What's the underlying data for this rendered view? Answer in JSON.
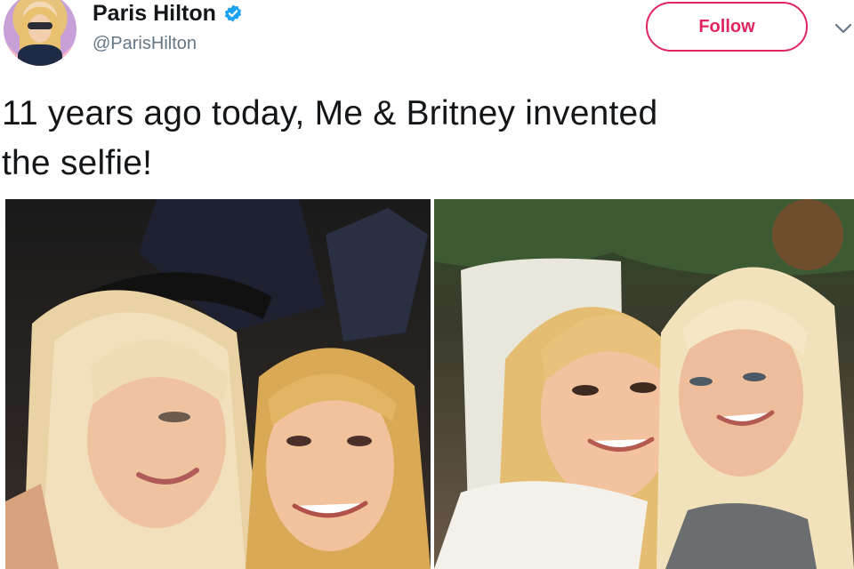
{
  "user": {
    "display_name": "Paris Hilton",
    "handle": "@ParisHilton",
    "verified": true,
    "avatar_icon": "profile-avatar"
  },
  "actions": {
    "follow_label": "Follow",
    "menu_icon": "chevron-down-icon"
  },
  "tweet": {
    "text_line1": "11 years ago today, Me & Britney invented",
    "text_line2": "the selfie!"
  },
  "media": {
    "count": 2,
    "photos": [
      {
        "name": "photo-left"
      },
      {
        "name": "photo-right"
      }
    ]
  },
  "colors": {
    "accent": "#e0245e",
    "verified_blue": "#1da1f2",
    "text_primary": "#14171a",
    "text_secondary": "#657786"
  }
}
